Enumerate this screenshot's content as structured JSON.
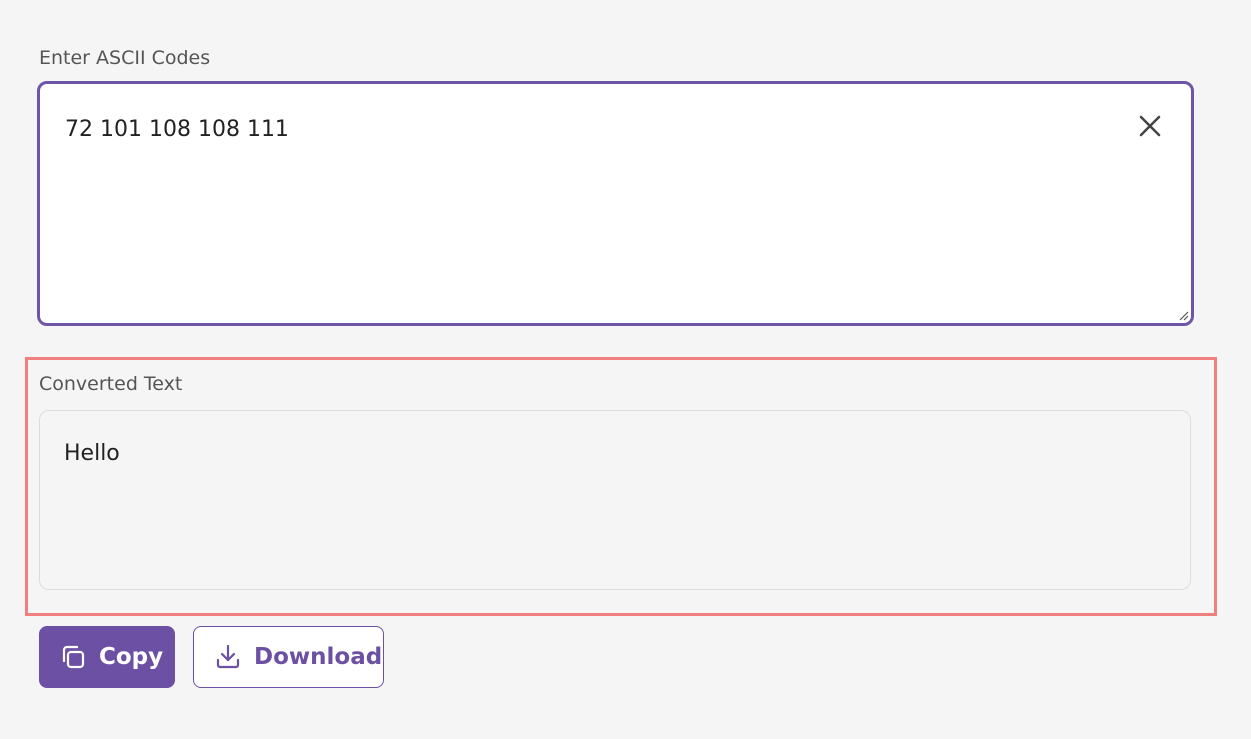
{
  "input": {
    "label": "Enter ASCII Codes",
    "value": "72 101 108 108 111"
  },
  "output": {
    "label": "Converted Text",
    "value": "Hello"
  },
  "actions": {
    "copy_label": "Copy",
    "download_label": "Download"
  },
  "colors": {
    "accent": "#6c50a3",
    "highlight": "#f08080",
    "background": "#f5f5f5"
  },
  "icons": {
    "clear": "close-icon",
    "copy": "copy-icon",
    "download": "download-icon"
  }
}
